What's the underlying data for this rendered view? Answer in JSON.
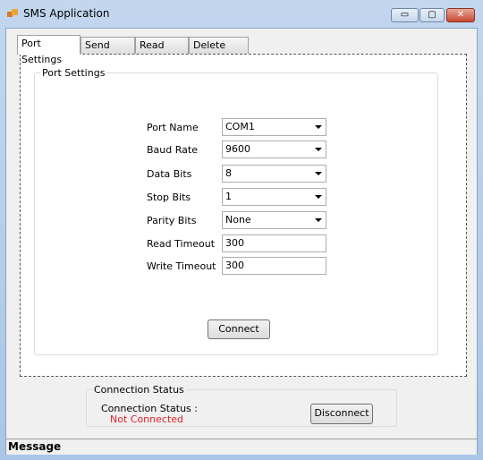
{
  "window": {
    "title": "SMS Application",
    "minimize": "▭",
    "maximize": "▢",
    "close": "✕"
  },
  "tabs": [
    {
      "label": "Port Settings",
      "active": true
    },
    {
      "label": "Send SMS"
    },
    {
      "label": "Read SMS"
    },
    {
      "label": "Delete SMS"
    }
  ],
  "port_settings": {
    "group_title": "Port Settings",
    "fields": [
      {
        "label": "Port Name",
        "value": "COM1",
        "type": "combo"
      },
      {
        "label": "Baud Rate",
        "value": "9600",
        "type": "combo"
      },
      {
        "label": "Data Bits",
        "value": "8",
        "type": "combo"
      },
      {
        "label": "Stop Bits",
        "value": "1",
        "type": "combo"
      },
      {
        "label": "Parity Bits",
        "value": "None",
        "type": "combo"
      },
      {
        "label": "Read Timeout",
        "value": "300",
        "type": "text"
      },
      {
        "label": "Write Timeout",
        "value": "300",
        "type": "text"
      }
    ],
    "connect_label": "Connect"
  },
  "connection": {
    "group_title": "Connection Status",
    "status_label": "Connection Status :",
    "status_value": "Not Connected",
    "status_color": "#e0202a",
    "disconnect_label": "Disconnect"
  },
  "status_bar": {
    "message": "Message"
  }
}
